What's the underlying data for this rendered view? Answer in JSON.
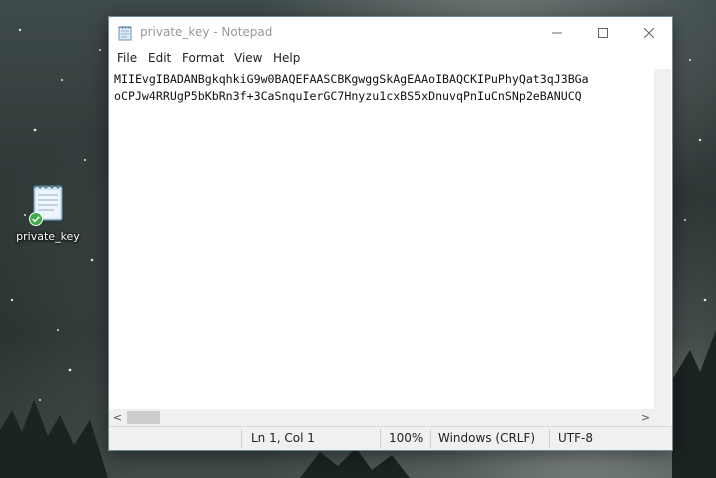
{
  "desktop": {
    "icon_label": "private_key"
  },
  "window": {
    "title": "private_key - Notepad",
    "controls": {
      "minimize": "—",
      "maximize": "☐",
      "close": "✕"
    }
  },
  "menu": [
    "File",
    "Edit",
    "Format",
    "View",
    "Help"
  ],
  "editor": {
    "lines": [
      "MIIEvgIBADANBgkqhkiG9w0BAQEFAASCBKgwggSkAgEAAoIBAQCKIPuPhyQat3qJ3BGa",
      "oCPJw4RRUgP5bKbRn3f+3CaSnquIerGC7Hnyzu1cxBS5xDnuvqPnIuCnSNp2eBANUCQ"
    ]
  },
  "scroll": {
    "left_arrow": "<",
    "right_arrow": ">"
  },
  "status": {
    "position": "Ln 1, Col 1",
    "zoom": "100%",
    "line_endings": "Windows (CRLF)",
    "encoding": "UTF-8"
  },
  "colors": {
    "titlebar_text": "#999999",
    "status_bg": "#f0f0f0",
    "window_border": "#6d8a96"
  }
}
